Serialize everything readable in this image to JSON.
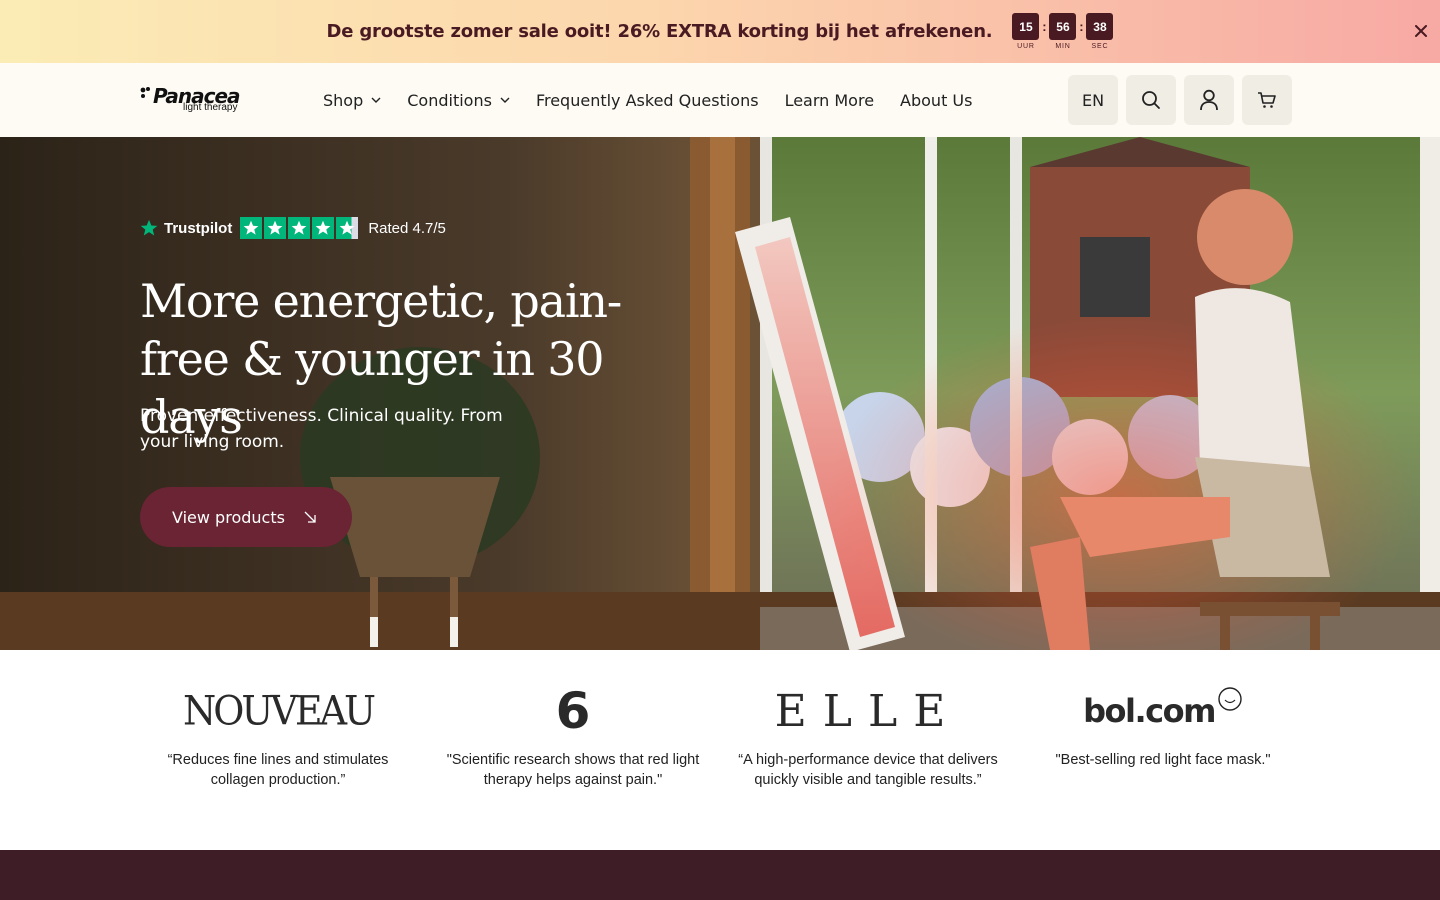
{
  "announcement": {
    "text": "De grootste zomer sale ooit! 26% EXTRA korting bij het afrekenen.",
    "countdown": [
      {
        "value": "15",
        "label": "UUR"
      },
      {
        "value": "56",
        "label": "MIN"
      },
      {
        "value": "38",
        "label": "SEC"
      }
    ],
    "separator": ":",
    "close_icon": "close-icon"
  },
  "header": {
    "logo": {
      "word": "Panacea",
      "sub": "light therapy"
    },
    "nav": [
      {
        "label": "Shop",
        "has_dropdown": true
      },
      {
        "label": "Conditions",
        "has_dropdown": true
      },
      {
        "label": "Frequently Asked Questions",
        "has_dropdown": false
      },
      {
        "label": "Learn More",
        "has_dropdown": false
      },
      {
        "label": "About Us",
        "has_dropdown": false
      }
    ],
    "language": "EN",
    "icons": [
      "search-icon",
      "account-icon",
      "cart-icon"
    ]
  },
  "hero": {
    "trustpilot_name": "Trustpilot",
    "rating_text": "Rated 4.7/5",
    "rating": 4.7,
    "title": "More energetic, pain-free & younger in 30 days",
    "subtitle": "Proven effectiveness. Clinical quality. From your living room.",
    "cta_label": "View products"
  },
  "press": [
    {
      "logo": "NOUVEAU",
      "quote": "“Reduces fine lines and stimulates collagen production.”"
    },
    {
      "logo": "6",
      "quote": "\"Scientific research shows that red light therapy helps against pain.\""
    },
    {
      "logo": "ELLE",
      "quote": "“A high-performance device that delivers quickly visible and tangible results.”"
    },
    {
      "logo": "bol.com",
      "quote": "\"Best-selling red light face mask.\""
    }
  ],
  "colors": {
    "brand": "#6a2433",
    "dark_band": "#3e1d27",
    "trustpilot_green": "#00b67a",
    "announcement_text": "#4a1a22"
  }
}
